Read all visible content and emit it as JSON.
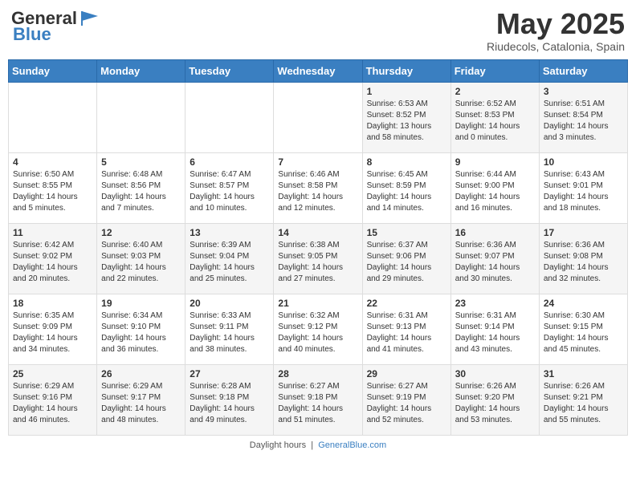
{
  "header": {
    "logo_general": "General",
    "logo_blue": "Blue",
    "month": "May 2025",
    "location": "Riudecols, Catalonia, Spain"
  },
  "days_of_week": [
    "Sunday",
    "Monday",
    "Tuesday",
    "Wednesday",
    "Thursday",
    "Friday",
    "Saturday"
  ],
  "weeks": [
    [
      {
        "day": "",
        "info": ""
      },
      {
        "day": "",
        "info": ""
      },
      {
        "day": "",
        "info": ""
      },
      {
        "day": "",
        "info": ""
      },
      {
        "day": "1",
        "info": "Sunrise: 6:53 AM\nSunset: 8:52 PM\nDaylight: 13 hours and 58 minutes."
      },
      {
        "day": "2",
        "info": "Sunrise: 6:52 AM\nSunset: 8:53 PM\nDaylight: 14 hours and 0 minutes."
      },
      {
        "day": "3",
        "info": "Sunrise: 6:51 AM\nSunset: 8:54 PM\nDaylight: 14 hours and 3 minutes."
      }
    ],
    [
      {
        "day": "4",
        "info": "Sunrise: 6:50 AM\nSunset: 8:55 PM\nDaylight: 14 hours and 5 minutes."
      },
      {
        "day": "5",
        "info": "Sunrise: 6:48 AM\nSunset: 8:56 PM\nDaylight: 14 hours and 7 minutes."
      },
      {
        "day": "6",
        "info": "Sunrise: 6:47 AM\nSunset: 8:57 PM\nDaylight: 14 hours and 10 minutes."
      },
      {
        "day": "7",
        "info": "Sunrise: 6:46 AM\nSunset: 8:58 PM\nDaylight: 14 hours and 12 minutes."
      },
      {
        "day": "8",
        "info": "Sunrise: 6:45 AM\nSunset: 8:59 PM\nDaylight: 14 hours and 14 minutes."
      },
      {
        "day": "9",
        "info": "Sunrise: 6:44 AM\nSunset: 9:00 PM\nDaylight: 14 hours and 16 minutes."
      },
      {
        "day": "10",
        "info": "Sunrise: 6:43 AM\nSunset: 9:01 PM\nDaylight: 14 hours and 18 minutes."
      }
    ],
    [
      {
        "day": "11",
        "info": "Sunrise: 6:42 AM\nSunset: 9:02 PM\nDaylight: 14 hours and 20 minutes."
      },
      {
        "day": "12",
        "info": "Sunrise: 6:40 AM\nSunset: 9:03 PM\nDaylight: 14 hours and 22 minutes."
      },
      {
        "day": "13",
        "info": "Sunrise: 6:39 AM\nSunset: 9:04 PM\nDaylight: 14 hours and 25 minutes."
      },
      {
        "day": "14",
        "info": "Sunrise: 6:38 AM\nSunset: 9:05 PM\nDaylight: 14 hours and 27 minutes."
      },
      {
        "day": "15",
        "info": "Sunrise: 6:37 AM\nSunset: 9:06 PM\nDaylight: 14 hours and 29 minutes."
      },
      {
        "day": "16",
        "info": "Sunrise: 6:36 AM\nSunset: 9:07 PM\nDaylight: 14 hours and 30 minutes."
      },
      {
        "day": "17",
        "info": "Sunrise: 6:36 AM\nSunset: 9:08 PM\nDaylight: 14 hours and 32 minutes."
      }
    ],
    [
      {
        "day": "18",
        "info": "Sunrise: 6:35 AM\nSunset: 9:09 PM\nDaylight: 14 hours and 34 minutes."
      },
      {
        "day": "19",
        "info": "Sunrise: 6:34 AM\nSunset: 9:10 PM\nDaylight: 14 hours and 36 minutes."
      },
      {
        "day": "20",
        "info": "Sunrise: 6:33 AM\nSunset: 9:11 PM\nDaylight: 14 hours and 38 minutes."
      },
      {
        "day": "21",
        "info": "Sunrise: 6:32 AM\nSunset: 9:12 PM\nDaylight: 14 hours and 40 minutes."
      },
      {
        "day": "22",
        "info": "Sunrise: 6:31 AM\nSunset: 9:13 PM\nDaylight: 14 hours and 41 minutes."
      },
      {
        "day": "23",
        "info": "Sunrise: 6:31 AM\nSunset: 9:14 PM\nDaylight: 14 hours and 43 minutes."
      },
      {
        "day": "24",
        "info": "Sunrise: 6:30 AM\nSunset: 9:15 PM\nDaylight: 14 hours and 45 minutes."
      }
    ],
    [
      {
        "day": "25",
        "info": "Sunrise: 6:29 AM\nSunset: 9:16 PM\nDaylight: 14 hours and 46 minutes."
      },
      {
        "day": "26",
        "info": "Sunrise: 6:29 AM\nSunset: 9:17 PM\nDaylight: 14 hours and 48 minutes."
      },
      {
        "day": "27",
        "info": "Sunrise: 6:28 AM\nSunset: 9:18 PM\nDaylight: 14 hours and 49 minutes."
      },
      {
        "day": "28",
        "info": "Sunrise: 6:27 AM\nSunset: 9:18 PM\nDaylight: 14 hours and 51 minutes."
      },
      {
        "day": "29",
        "info": "Sunrise: 6:27 AM\nSunset: 9:19 PM\nDaylight: 14 hours and 52 minutes."
      },
      {
        "day": "30",
        "info": "Sunrise: 6:26 AM\nSunset: 9:20 PM\nDaylight: 14 hours and 53 minutes."
      },
      {
        "day": "31",
        "info": "Sunrise: 6:26 AM\nSunset: 9:21 PM\nDaylight: 14 hours and 55 minutes."
      }
    ]
  ],
  "footer": {
    "text": "Daylight hours",
    "link": "GeneralBlue.com"
  }
}
